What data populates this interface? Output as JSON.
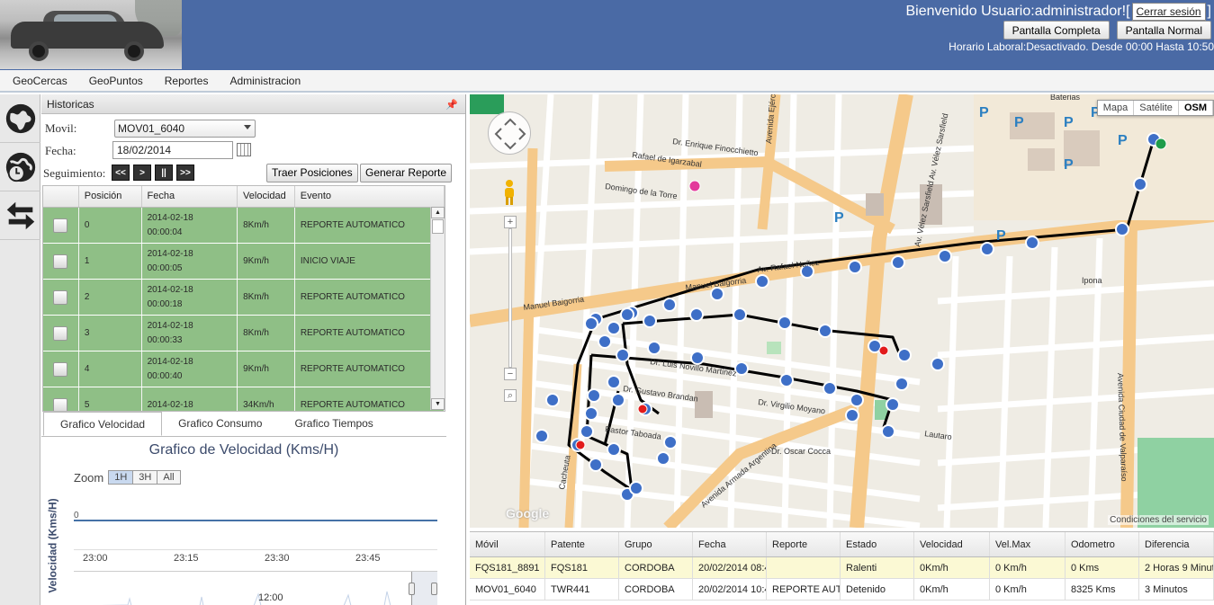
{
  "header": {
    "welcome": "Bienvenido Usuario:administrador![",
    "logout": "Cerrar sesión",
    "bracket_close": "]",
    "btn_full": "Pantalla Completa",
    "btn_normal": "Pantalla Normal",
    "horario": "Horario Laboral:Desactivado. Desde 00:00 Hasta 10:50"
  },
  "menu": [
    "GeoCercas",
    "GeoPuntos",
    "Reportes",
    "Administracion"
  ],
  "side_icons": [
    "globe-icon",
    "globe-clock-icon",
    "swap-arrows-icon"
  ],
  "historicas": {
    "title": "Historicas",
    "movil_label": "Movil:",
    "movil_value": "MOV01_6040",
    "fecha_label": "Fecha:",
    "fecha_value": "18/02/2014",
    "seguimiento_label": "Seguimiento:",
    "seg_buttons": [
      "<<",
      ">",
      "||",
      ">>"
    ],
    "traer_btn": "Traer Posiciones",
    "generar_btn": "Generar Reporte",
    "columns": [
      "",
      "Posición",
      "Fecha",
      "Velocidad",
      "Evento"
    ],
    "rows": [
      {
        "pos": "0",
        "date": "2014-02-18",
        "time": "00:00:04",
        "vel": "8Km/h",
        "evento": "REPORTE AUTOMATICO"
      },
      {
        "pos": "1",
        "date": "2014-02-18",
        "time": "00:00:05",
        "vel": "9Km/h",
        "evento": "INICIO VIAJE"
      },
      {
        "pos": "2",
        "date": "2014-02-18",
        "time": "00:00:18",
        "vel": "8Km/h",
        "evento": "REPORTE AUTOMATICO"
      },
      {
        "pos": "3",
        "date": "2014-02-18",
        "time": "00:00:33",
        "vel": "8Km/h",
        "evento": "REPORTE AUTOMATICO"
      },
      {
        "pos": "4",
        "date": "2014-02-18",
        "time": "00:00:40",
        "vel": "9Km/h",
        "evento": "REPORTE AUTOMATICO"
      },
      {
        "pos": "5",
        "date": "2014-02-18",
        "time": "",
        "vel": "34Km/h",
        "evento": "REPORTE AUTOMATICO"
      }
    ]
  },
  "tabs": [
    "Grafico Velocidad",
    "Grafico Consumo",
    "Grafico Tiempos"
  ],
  "chart": {
    "title": "Grafico de Velocidad (Kms/H)",
    "zoom_label": "Zoom",
    "zoom_options": [
      "1H",
      "3H",
      "All"
    ],
    "ylabel": "Velocidad (Kms/H)",
    "y_tick": "0",
    "x_ticks": [
      "23:00",
      "23:15",
      "23:30",
      "23:45"
    ],
    "navigator_label": "12:00"
  },
  "map": {
    "types": [
      "Mapa",
      "Satélite",
      "OSM"
    ],
    "active_type": "OSM",
    "terms": "Condiciones del servicio",
    "google": "Google",
    "street_labels": [
      {
        "t": "Manuel Baigorria",
        "x": 60,
        "y": 240,
        "r": -8
      },
      {
        "t": "Manuel Baigorria",
        "x": 240,
        "y": 218,
        "r": -7
      },
      {
        "t": "Av. Rafael Nuñez",
        "x": 320,
        "y": 198,
        "r": -7
      },
      {
        "t": "Av. Vélez Sarsfield Av. Vélez Sarsfield",
        "x": 500,
        "y": 170,
        "r": -78
      },
      {
        "t": "Avenida Ciudad de Valparaíso",
        "x": 720,
        "y": 310,
        "r": 88
      },
      {
        "t": "Avenida Armada Argentina",
        "x": 260,
        "y": 460,
        "r": -40
      },
      {
        "t": "Cacheuta",
        "x": 105,
        "y": 440,
        "r": -80
      },
      {
        "t": "Dr. Virgilio Moyano",
        "x": 320,
        "y": 345,
        "r": 8
      },
      {
        "t": "Dr. Luis Novillo Martinez",
        "x": 200,
        "y": 300,
        "r": 8
      },
      {
        "t": "Dr. Gustavo Brandan",
        "x": 170,
        "y": 330,
        "r": 8
      },
      {
        "t": "Pastor Taboada",
        "x": 150,
        "y": 375,
        "r": 8
      },
      {
        "t": "Rafael de Igarzabal",
        "x": 180,
        "y": 70,
        "r": 8
      },
      {
        "t": "Dr. Enrique Finocchietto",
        "x": 225,
        "y": 55,
        "r": 8
      },
      {
        "t": "Domingo de la Torre",
        "x": 150,
        "y": 105,
        "r": 8
      },
      {
        "t": "Lautaro",
        "x": 505,
        "y": 380,
        "r": 8
      },
      {
        "t": "Ipona",
        "x": 680,
        "y": 210,
        "r": 0
      },
      {
        "t": "Dr. Oscar Cocca",
        "x": 335,
        "y": 400,
        "r": 0
      },
      {
        "t": "Avenida Ejército Argentino",
        "x": 335,
        "y": 55,
        "r": -85
      },
      {
        "t": "Baterias",
        "x": 645,
        "y": 6,
        "r": 0
      }
    ]
  },
  "bottom_grid": {
    "columns": [
      "Móvil",
      "Patente",
      "Grupo",
      "Fecha",
      "Reporte",
      "Estado",
      "Velocidad",
      "Vel.Max",
      "Odometro",
      "Diferencia"
    ],
    "rows": [
      [
        "FQS181_8891",
        "FQS181",
        "CORDOBA",
        "20/02/2014 08:4",
        "",
        "Ralenti",
        "0Km/h",
        "0 Km/h",
        "0 Kms",
        "2 Horas 9 Minut"
      ],
      [
        "MOV01_6040",
        "TWR441",
        "CORDOBA",
        "20/02/2014 10:4",
        "REPORTE AUT",
        "Detenido",
        "0Km/h",
        "0 Km/h",
        "8325 Kms",
        "3 Minutos"
      ]
    ]
  }
}
